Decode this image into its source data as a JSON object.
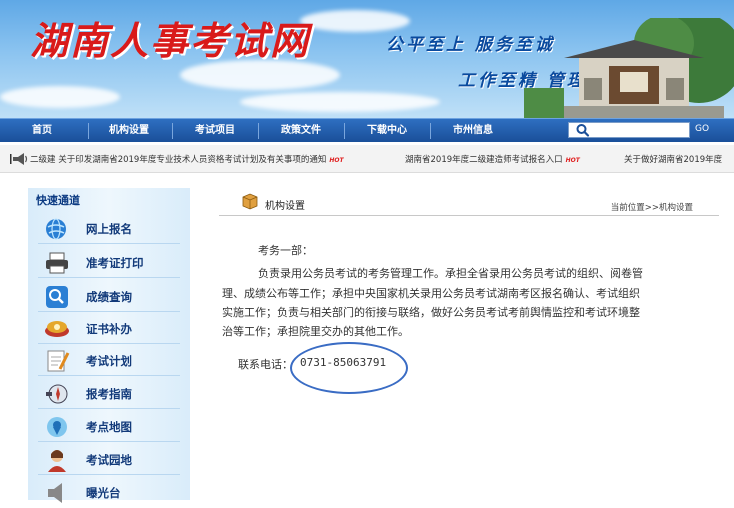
{
  "banner": {
    "logo": "湖南人事考试网",
    "slogan_line1": "公平至上  服务至诚",
    "slogan_line2": "工作至精  管理至严"
  },
  "nav": {
    "items": [
      "首页",
      "机构设置",
      "考试项目",
      "政策文件",
      "下载中心",
      "市州信息"
    ],
    "go_label": "GO"
  },
  "ticker": {
    "items": [
      "二级建  关于印发湖南省2019年度专业技术人员资格考试计划及有关事项的通知",
      "湖南省2019年度二级建造师考试报名入口",
      "关于做好湖南省2019年度"
    ],
    "hot_label": "HOT"
  },
  "sidebar": {
    "title": "快速通道",
    "items": [
      {
        "label": "网上报名",
        "icon": "globe-icon"
      },
      {
        "label": "准考证打印",
        "icon": "printer-icon"
      },
      {
        "label": "成绩查询",
        "icon": "magnifier-icon"
      },
      {
        "label": "证书补办",
        "icon": "certificate-icon"
      },
      {
        "label": "考试计划",
        "icon": "notepad-icon"
      },
      {
        "label": "报考指南",
        "icon": "compass-icon"
      },
      {
        "label": "考点地图",
        "icon": "map-pin-icon"
      },
      {
        "label": "考试园地",
        "icon": "person-icon"
      },
      {
        "label": "曝光台",
        "icon": "speaker-icon"
      }
    ]
  },
  "main": {
    "title": "机构设置",
    "breadcrumb": "当前位置>>机构设置",
    "dept": "考务一部：",
    "lines": [
      "负责录用公务员考试的考务管理工作。承担全省录用公务员考试的组织、阅卷管",
      "理、成绩公布等工作；承担中央国家机关录用公务员考试湖南考区报名确认、考试组织",
      "实施工作；负责与相关部门的衔接与联络，做好公务员考试考前舆情监控和考试环境整",
      "治等工作；承担院里交办的其他工作。"
    ],
    "phone_label": "联系电话：",
    "phone_value": "0731-85063791"
  },
  "colors": {
    "nav_bg": "#1a4f99",
    "logo_red": "#d91a1a",
    "slogan_blue": "#0a4a9e",
    "highlight_circle": "#3a6cc4"
  }
}
